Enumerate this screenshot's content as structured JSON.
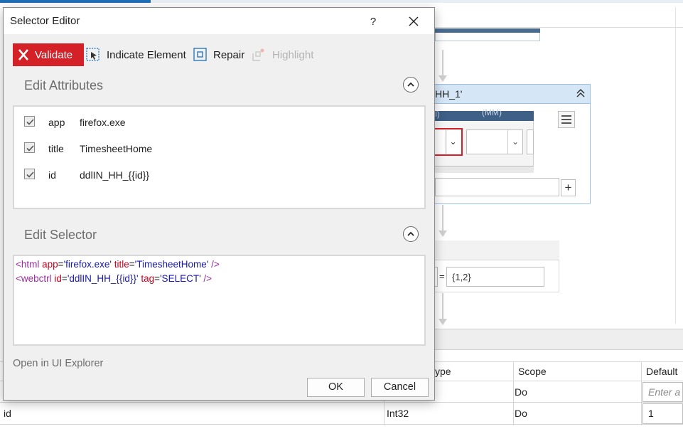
{
  "designer": {
    "activity_title": "HH_1'",
    "table_headers": {
      "hh": "I)",
      "mm": "(MM)"
    },
    "assign_value": "{1,2}",
    "assign_eq": "="
  },
  "variables": {
    "headers": {
      "type": "ype",
      "scope": "Scope",
      "default": "Default"
    },
    "rows": [
      {
        "name": "",
        "type": "",
        "scope": "Do",
        "default_placeholder": "Enter a"
      },
      {
        "name": "id",
        "type": "Int32",
        "scope": "Do",
        "default": "1"
      }
    ]
  },
  "dialog": {
    "title": "Selector Editor",
    "help": "?",
    "toolbar": {
      "validate": "Validate",
      "indicate": "Indicate Element",
      "repair": "Repair",
      "highlight": "Highlight"
    },
    "attributes_title": "Edit Attributes",
    "attributes": [
      {
        "name": "app",
        "value": "firefox.exe",
        "checked": true
      },
      {
        "name": "title",
        "value": "TimesheetHome",
        "checked": true
      },
      {
        "name": "id",
        "value": "ddlIN_HH_{{id}}",
        "checked": true
      }
    ],
    "selector_title": "Edit Selector",
    "selector": {
      "line1": {
        "open": "<html ",
        "a1": "app",
        "eq1": "=",
        "v1": "'firefox.exe'",
        "sp": " ",
        "a2": "title",
        "eq2": "=",
        "v2": "'TimesheetHome'",
        "close": " />"
      },
      "line2": {
        "open": "<webctrl ",
        "a1": "id",
        "eq1": "=",
        "v1": "'ddlIN_HH_{{id}}'",
        "sp": " ",
        "a2": "tag",
        "eq2": "=",
        "v2": "'SELECT'",
        "close": " />"
      }
    },
    "explorer_link": "Open in UI Explorer",
    "ok": "OK",
    "cancel": "Cancel"
  },
  "colors": {
    "validate_bg": "#d42027",
    "accent": "#1f6fb5",
    "tag": "#9a2d9f",
    "attr": "#c8001e",
    "value": "#1a1aa6"
  }
}
